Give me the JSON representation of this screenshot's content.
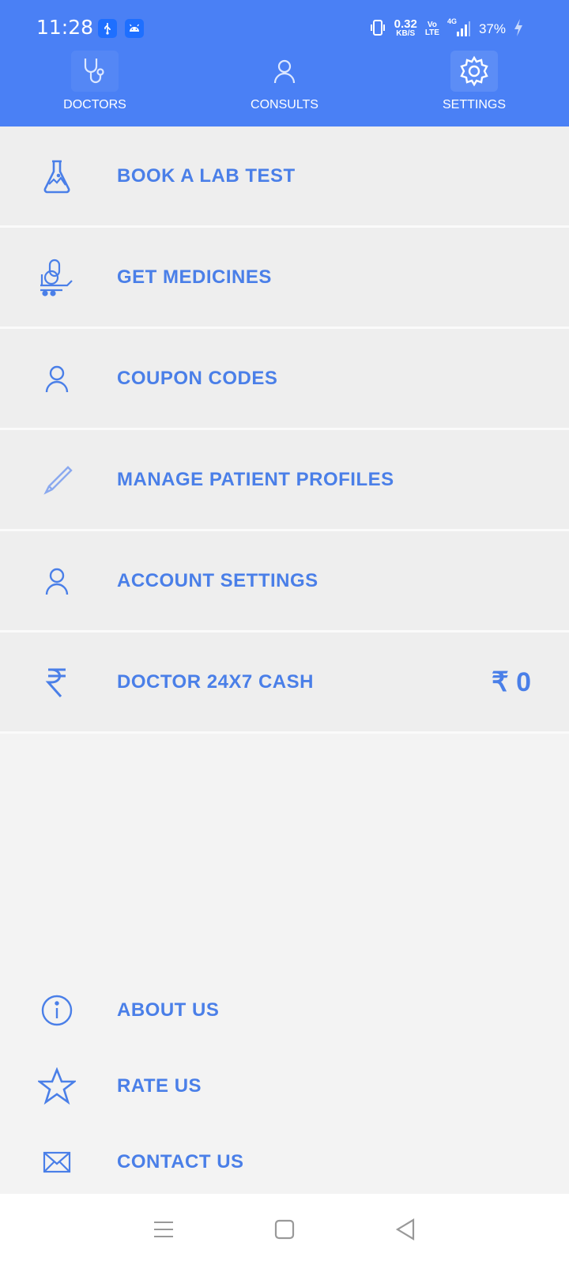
{
  "status_bar": {
    "time": "11:28",
    "net_speed": "0.32",
    "net_unit": "KB/S",
    "volte_top": "Vo",
    "volte_bottom": "LTE",
    "network": "4G",
    "battery": "37%"
  },
  "tabs": [
    {
      "label": "DOCTORS",
      "icon": "stethoscope-icon"
    },
    {
      "label": "CONSULTS",
      "icon": "user-icon"
    },
    {
      "label": "SETTINGS",
      "icon": "gear-icon",
      "active": true
    }
  ],
  "menu": [
    {
      "label": "BOOK A LAB TEST",
      "icon": "flask-icon"
    },
    {
      "label": "GET MEDICINES",
      "icon": "medicine-cart-icon"
    },
    {
      "label": "COUPON CODES",
      "icon": "user-icon"
    },
    {
      "label": "MANAGE PATIENT PROFILES",
      "icon": "pencil-icon"
    },
    {
      "label": "ACCOUNT SETTINGS",
      "icon": "user-icon"
    },
    {
      "label": "DOCTOR 24X7 CASH",
      "icon": "rupee-icon",
      "amount": "₹ 0"
    }
  ],
  "bottom_links": [
    {
      "label": "ABOUT US",
      "icon": "info-icon"
    },
    {
      "label": "RATE US",
      "icon": "star-icon"
    },
    {
      "label": "CONTACT US",
      "icon": "envelope-icon"
    }
  ],
  "colors": {
    "primary": "#4a80f5",
    "text_accent": "#4a7fe8",
    "row_bg": "#eeeeee",
    "page_bg": "#f3f3f3"
  }
}
